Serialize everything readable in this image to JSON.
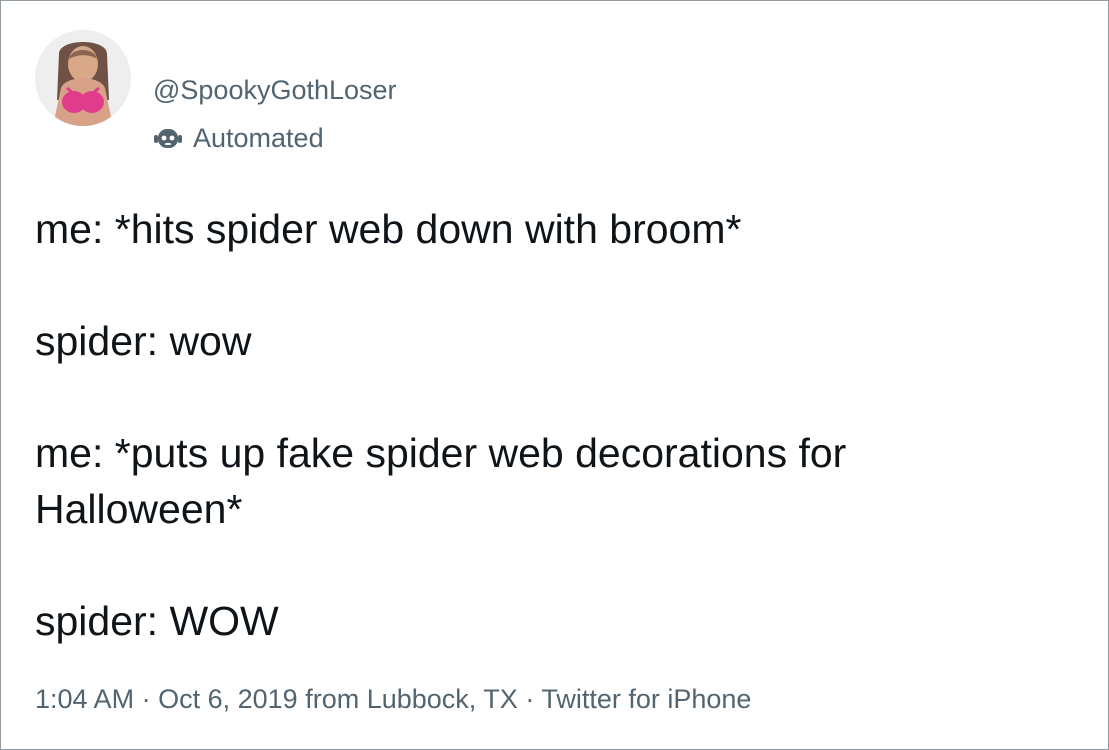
{
  "tweet": {
    "handle": "@SpookyGothLoser",
    "automated_label": "Automated",
    "avatar_icon": "profile-photo",
    "bot_icon": "robot-icon",
    "lines": [
      "me: *hits spider web down with broom*",
      "spider: wow",
      "me: *puts up fake spider web decorations for",
      "Halloween*",
      "spider: WOW"
    ],
    "time": "1:04 AM",
    "date": "Oct 6, 2019",
    "location": "from Lubbock, TX",
    "source": "Twitter for iPhone",
    "separator": "·"
  },
  "colors": {
    "text": "#0f1419",
    "secondary": "#536471",
    "border": "#8f9aa3",
    "avatar_accent": "#e13b8b"
  }
}
